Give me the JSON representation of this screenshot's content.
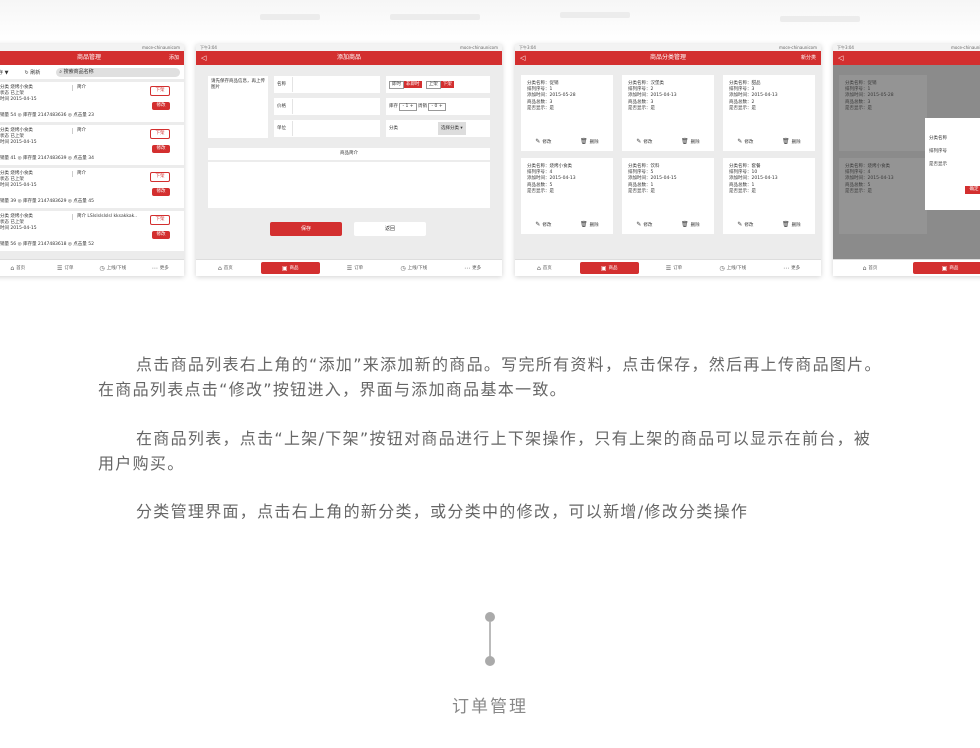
{
  "common": {
    "status_time": "下午3:04",
    "status_carrier": "moce-chinaunicom",
    "tabs": [
      {
        "icon": "⌂",
        "label": "首页"
      },
      {
        "icon": "▣",
        "label": "商品"
      },
      {
        "icon": "☰",
        "label": "订单"
      },
      {
        "icon": "◷",
        "label": "上线/下线"
      },
      {
        "icon": "⋯",
        "label": "更多"
      }
    ]
  },
  "screen1": {
    "title": "商品管理",
    "right_action": "添加",
    "filter_label": "存 ▼",
    "refresh_label": "刷新",
    "search_placeholder": "搜索商品名称",
    "items": [
      {
        "name": "分类 烧烤小食类",
        "status": "状态 已上架",
        "time": "时间 2015-04-15",
        "intro": "简介",
        "stats": "销量 54  ◎ 库存量 2147483636  ◎ 点击量 23",
        "btn1": "下架",
        "btn2": "修改"
      },
      {
        "name": "分类 烧烤小食类",
        "status": "状态 已上架",
        "time": "时间 2015-04-15",
        "intro": "简介",
        "stats": "销量 41  ◎ 库存量 2147483639  ◎ 点击量 34",
        "btn1": "下架",
        "btn2": "修改"
      },
      {
        "name": "分类 烧烤小食类",
        "status": "状态 已上架",
        "time": "时间 2015-04-15",
        "intro": "简介",
        "stats": "销量 39  ◎ 库存量 2147483629  ◎ 点击量 45",
        "btn1": "下架",
        "btn2": "修改"
      },
      {
        "name": "分类 烧烤小食类",
        "status": "状态 已上架",
        "time": "时间 2015-04-15",
        "intro": "简介 LSlslslslslsl kksakkak..",
        "stats": "销量 56  ◎ 库存量 2147483618  ◎ 点击量 52",
        "btn1": "下架",
        "btn2": "修改"
      }
    ]
  },
  "screen2": {
    "title": "添加商品",
    "hint": "请先保存商品信息，再上传图片",
    "name_label": "名称",
    "price_label": "价格",
    "unit_label": "单位",
    "time_label": "即时",
    "time_value": "非即时",
    "shelf_label": "上架",
    "shelf_value": "下架",
    "stock_label": "库存",
    "stock_value": "1",
    "week_label": "周销",
    "week_value": "0",
    "category_label": "分类",
    "category_value": "选择分类",
    "desc_title": "商品简介",
    "save_label": "保存",
    "back_label": "返回"
  },
  "screen3": {
    "title": "商品分类管理",
    "right_action": "新分类",
    "edit_label": "修改",
    "delete_label": "删除",
    "cards": [
      {
        "name": "分类名称：促销",
        "order": "排列序号：1",
        "time": "添加时间：2015-05-28",
        "count": "商品总数：3",
        "show": "是否显示：是"
      },
      {
        "name": "分类名称：汉堡类",
        "order": "排列序号：2",
        "time": "添加时间：2015-04-13",
        "count": "商品总数：3",
        "show": "是否显示：是"
      },
      {
        "name": "分类名称：甜品",
        "order": "排列序号：3",
        "time": "添加时间：2015-04-13",
        "count": "商品总数：2",
        "show": "是否显示：是"
      },
      {
        "name": "分类名称：烧烤小食类",
        "order": "排列序号：4",
        "time": "添加时间：2015-04-13",
        "count": "商品总数：5",
        "show": "是否显示：是"
      },
      {
        "name": "分类名称：饮料",
        "order": "排列序号：5",
        "time": "添加时间：2015-04-15",
        "count": "商品总数：1",
        "show": "是否显示：是"
      },
      {
        "name": "分类名称：套餐",
        "order": "排列序号：10",
        "time": "添加时间：2015-04-13",
        "count": "商品总数：1",
        "show": "是否显示：是"
      }
    ]
  },
  "screen4": {
    "cards": [
      {
        "name": "分类名称：促销",
        "order": "排列序号：1",
        "time": "添加时间：2015-05-28",
        "count": "商品总数：3",
        "show": "是否显示：是"
      },
      {
        "name": "分类名称：烧烤小食类",
        "order": "排列序号：4",
        "time": "添加时间：2015-04-13",
        "count": "商品总数：5",
        "show": "是否显示：是"
      }
    ],
    "dialog_title": "修",
    "dialog_name": "分类名称",
    "dialog_order": "排列序号",
    "dialog_show": "是否显示",
    "dialog_ok": "确定"
  },
  "text": {
    "p1": "点击商品列表右上角的“添加”来添加新的商品。写完所有资料，点击保存，然后再上传商品图片。在商品列表点击“修改”按钮进入，界面与添加商品基本一致。",
    "p2": "在商品列表，点击“上架/下架”按钮对商品进行上下架操作，只有上架的商品可以显示在前台，被用户购买。",
    "p3": "分类管理界面，点击右上角的新分类，或分类中的修改，可以新增/修改分类操作",
    "section_title": "订单管理"
  },
  "colors": {
    "accent": "#d32f2f",
    "text": "#666666",
    "background": "#ffffff"
  }
}
